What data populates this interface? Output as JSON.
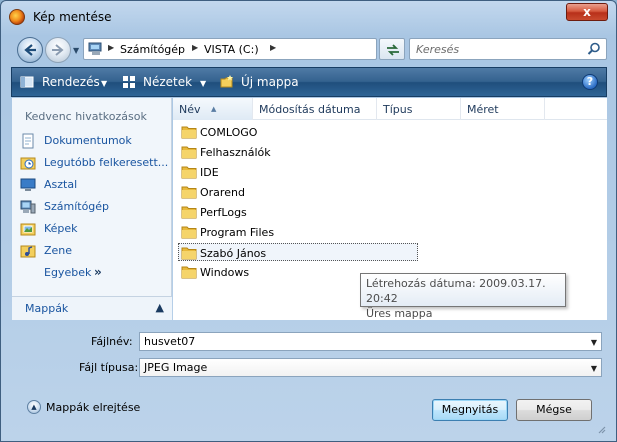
{
  "window": {
    "title": "Kép mentése",
    "close_label": "x"
  },
  "address": {
    "crumbs": [
      "Számítógép",
      "VISTA (C:)"
    ]
  },
  "search": {
    "placeholder": "Keresés"
  },
  "toolbar": {
    "organize": "Rendezés",
    "views": "Nézetek",
    "new_folder": "Új mappa",
    "help": "?"
  },
  "favorites": {
    "header": "Kedvenc hivatkozások",
    "items": [
      {
        "label": "Dokumentumok",
        "icon": "documents-icon"
      },
      {
        "label": "Legutóbb felkeresett...",
        "icon": "recent-places-icon"
      },
      {
        "label": "Asztal",
        "icon": "desktop-icon"
      },
      {
        "label": "Számítógép",
        "icon": "computer-icon"
      },
      {
        "label": "Képek",
        "icon": "pictures-icon"
      },
      {
        "label": "Zene",
        "icon": "music-icon"
      },
      {
        "label": "Egyebek",
        "icon": "more-chevron-icon"
      }
    ],
    "folders_label": "Mappák"
  },
  "columns": [
    "Név",
    "Módosítás dátuma",
    "Típus",
    "Méret"
  ],
  "files": [
    {
      "name": "COMLOGO",
      "selected": false
    },
    {
      "name": "Felhasználók",
      "selected": false
    },
    {
      "name": "IDE",
      "selected": false
    },
    {
      "name": "Orarend",
      "selected": false
    },
    {
      "name": "PerfLogs",
      "selected": false
    },
    {
      "name": "Program Files",
      "selected": false
    },
    {
      "name": "Szabó János",
      "selected": true
    },
    {
      "name": "Windows",
      "selected": false
    }
  ],
  "tooltip": {
    "line1": "Létrehozás dátuma: 2009.03.17. 20:42",
    "line2": "Üres mappa"
  },
  "form": {
    "filename_label": "Fájlnév:",
    "filename_value": "husvet07",
    "filetype_label": "Fájl típusa:",
    "filetype_value": "JPEG Image",
    "hide_folders": "Mappák elrejtése",
    "save_label": "Megnyitás",
    "cancel_label": "Mégse"
  }
}
